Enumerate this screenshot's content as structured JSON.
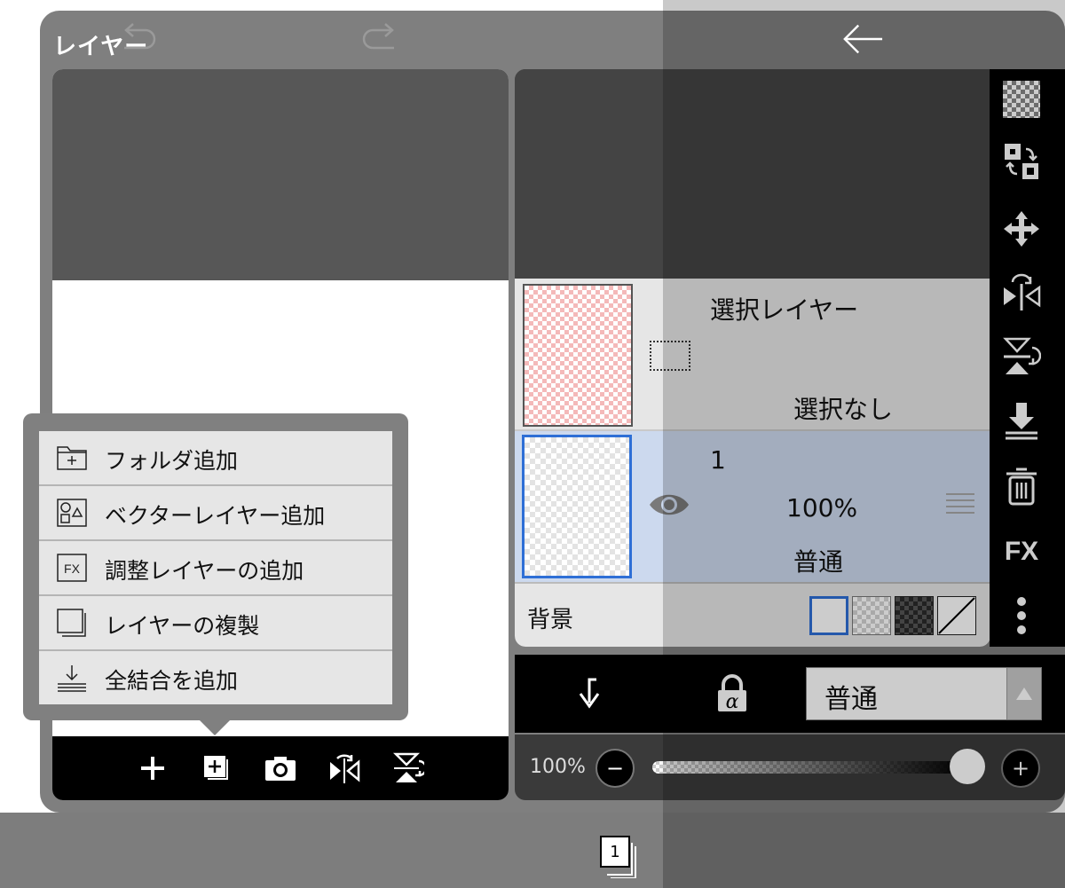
{
  "panel": {
    "title": "レイヤー"
  },
  "selection_layer": {
    "title": "選択レイヤー",
    "status": "選択なし"
  },
  "layer1": {
    "name": "1",
    "opacity": "100%",
    "blend_mode": "普通"
  },
  "background": {
    "label": "背景"
  },
  "blend": {
    "mode": "普通"
  },
  "opacity_row": {
    "label": "100%",
    "minus": "−",
    "plus": "+",
    "value_percent": 100
  },
  "popup_menu": {
    "items": [
      {
        "label": "フォルダ追加",
        "icon": "folder-add-icon"
      },
      {
        "label": "ベクターレイヤー追加",
        "icon": "vector-layer-icon"
      },
      {
        "label": "調整レイヤーの追加",
        "icon": "fx-adjust-icon"
      },
      {
        "label": "レイヤーの複製",
        "icon": "duplicate-icon"
      },
      {
        "label": "全結合を追加",
        "icon": "merge-all-icon"
      }
    ]
  },
  "right_toolbar": {
    "fx_label": "FX"
  },
  "bottom_bar": {
    "page_number": "1"
  },
  "colors": {
    "accent": "#2e6fd6",
    "selected_layer_bg": "#ccd9ee",
    "panel_bg": "#7f7f7f"
  }
}
